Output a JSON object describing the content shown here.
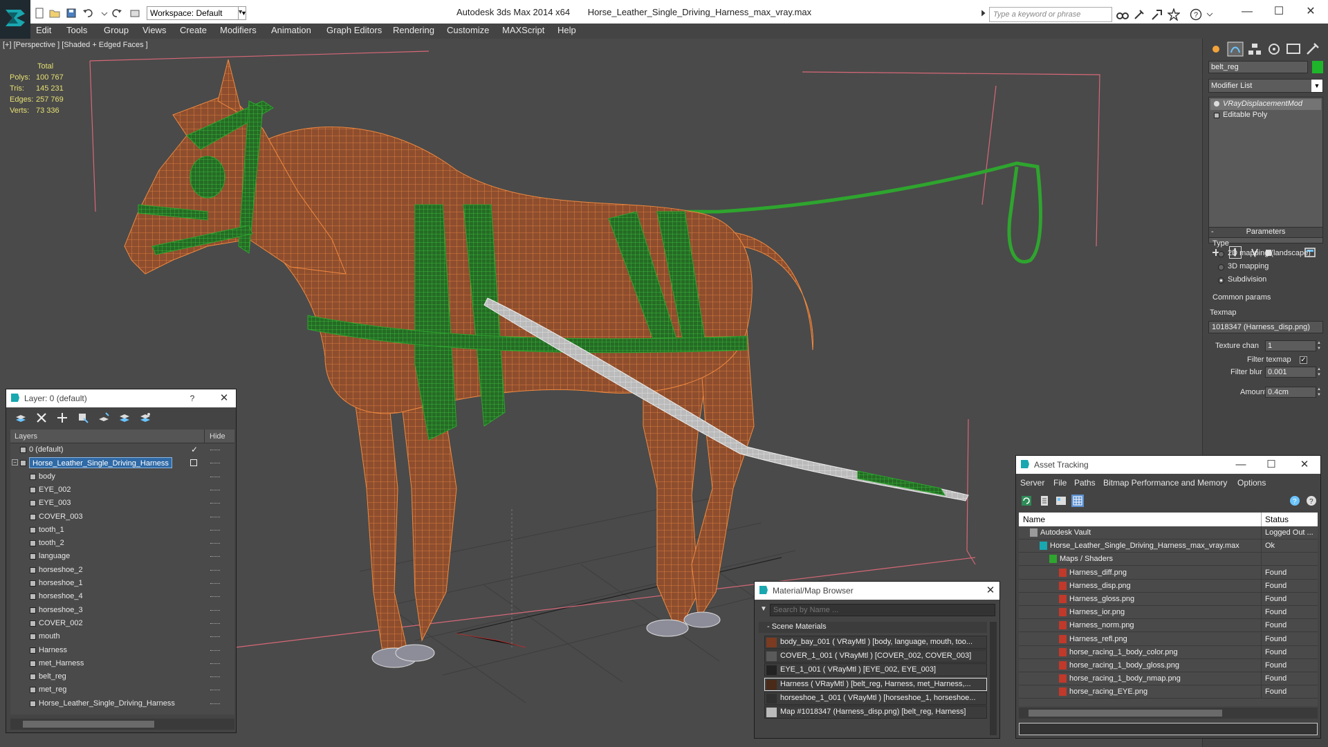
{
  "titlebar": {
    "workspace_label": "Workspace: Default",
    "app_name": "Autodesk 3ds Max  2014 x64",
    "file_name": "Horse_Leather_Single_Driving_Harness_max_vray.max",
    "search_placeholder": "Type a keyword or phrase"
  },
  "menubar": {
    "items": [
      "Edit",
      "Tools",
      "Group",
      "Views",
      "Create",
      "Modifiers",
      "Animation",
      "Graph Editors",
      "Rendering",
      "Customize",
      "MAXScript",
      "Help"
    ]
  },
  "viewport": {
    "label": "[+] [Perspective ] [Shaded + Edged Faces ]",
    "stats": {
      "header": "Total",
      "rows": [
        {
          "label": "Polys:",
          "value": "100 767"
        },
        {
          "label": "Tris:",
          "value": "145 231"
        },
        {
          "label": "Edges:",
          "value": "257 769"
        },
        {
          "label": "Verts:",
          "value": "73 336"
        }
      ]
    },
    "colors": {
      "background": "#4a4a4a",
      "horse": "#8a4a2c",
      "wire": "#f08a40",
      "harness": "#2ea52e"
    }
  },
  "command_panel": {
    "object_name": "belt_reg",
    "object_color": "#1fb52b",
    "modifier_list_label": "Modifier List",
    "stack": [
      "VRayDisplacementMod",
      "Editable Poly"
    ],
    "parameters_title": "Parameters",
    "type_label": "Type",
    "type_options": [
      "2D mapping (landscape)",
      "3D mapping",
      "Subdivision"
    ],
    "type_selected": 2,
    "common_params_label": "Common params",
    "texmap_label": "Texmap",
    "texmap_value": "1018347 (Harness_disp.png)",
    "texture_chan_label": "Texture chan",
    "texture_chan_value": "1",
    "filter_texmap_label": "Filter texmap",
    "filter_blur_label": "Filter blur",
    "filter_blur_value": "0.001",
    "amount_label": "Amount",
    "amount_value": "0.4cm"
  },
  "layer_manager": {
    "title": "Layer: 0 (default)",
    "help": "?",
    "col_layers": "Layers",
    "col_hide": "Hide",
    "rows": [
      {
        "label": "0 (default)",
        "indent": 1,
        "check": "✓"
      },
      {
        "label": "Horse_Leather_Single_Driving_Harness",
        "indent": 1,
        "active": true
      },
      {
        "label": "body",
        "indent": 2
      },
      {
        "label": "EYE_002",
        "indent": 2
      },
      {
        "label": "EYE_003",
        "indent": 2
      },
      {
        "label": "COVER_003",
        "indent": 2
      },
      {
        "label": "tooth_1",
        "indent": 2
      },
      {
        "label": "tooth_2",
        "indent": 2
      },
      {
        "label": "language",
        "indent": 2
      },
      {
        "label": "horseshoe_2",
        "indent": 2
      },
      {
        "label": "horseshoe_1",
        "indent": 2
      },
      {
        "label": "horseshoe_4",
        "indent": 2
      },
      {
        "label": "horseshoe_3",
        "indent": 2
      },
      {
        "label": "COVER_002",
        "indent": 2
      },
      {
        "label": "mouth",
        "indent": 2
      },
      {
        "label": "Harness",
        "indent": 2
      },
      {
        "label": "met_Harness",
        "indent": 2
      },
      {
        "label": "belt_reg",
        "indent": 2
      },
      {
        "label": "met_reg",
        "indent": 2
      },
      {
        "label": "Horse_Leather_Single_Driving_Harness",
        "indent": 2
      }
    ]
  },
  "material_browser": {
    "title": "Material/Map Browser",
    "search_placeholder": "Search by Name ...",
    "section": "- Scene Materials",
    "rows": [
      "body_bay_001  ( VRayMtl ) [body, language, mouth, too...",
      "COVER_1_001  ( VRayMtl ) [COVER_002, COVER_003]",
      "EYE_1_001  ( VRayMtl ) [EYE_002, EYE_003]",
      "Harness  ( VRayMtl ) [belt_reg, Harness, met_Harness,...",
      "horseshoe_1_001  ( VRayMtl ) [horseshoe_1, horseshoe...",
      "Map #1018347 (Harness_disp.png)  [belt_reg, Harness]"
    ],
    "selected": 3
  },
  "asset_tracking": {
    "title": "Asset Tracking",
    "menu": [
      "Server",
      "File",
      "Paths",
      "Bitmap Performance and Memory",
      "Options"
    ],
    "col_name": "Name",
    "col_status": "Status",
    "rows": [
      {
        "name": "Autodesk Vault",
        "status": "Logged Out ...",
        "indent": 1,
        "icon": "vault"
      },
      {
        "name": "Horse_Leather_Single_Driving_Harness_max_vray.max",
        "status": "Ok",
        "indent": 2,
        "icon": "max"
      },
      {
        "name": "Maps / Shaders",
        "status": "",
        "indent": 3,
        "icon": "maps"
      },
      {
        "name": "Harness_diff.png",
        "status": "Found",
        "indent": 4,
        "icon": "png"
      },
      {
        "name": "Harness_disp.png",
        "status": "Found",
        "indent": 4,
        "icon": "png"
      },
      {
        "name": "Harness_gloss.png",
        "status": "Found",
        "indent": 4,
        "icon": "png"
      },
      {
        "name": "Harness_ior.png",
        "status": "Found",
        "indent": 4,
        "icon": "png"
      },
      {
        "name": "Harness_norm.png",
        "status": "Found",
        "indent": 4,
        "icon": "png"
      },
      {
        "name": "Harness_refl.png",
        "status": "Found",
        "indent": 4,
        "icon": "png"
      },
      {
        "name": "horse_racing_1_body_color.png",
        "status": "Found",
        "indent": 4,
        "icon": "png"
      },
      {
        "name": "horse_racing_1_body_gloss.png",
        "status": "Found",
        "indent": 4,
        "icon": "png"
      },
      {
        "name": "horse_racing_1_body_nmap.png",
        "status": "Found",
        "indent": 4,
        "icon": "png"
      },
      {
        "name": "horse_racing_EYE.png",
        "status": "Found",
        "indent": 4,
        "icon": "png"
      }
    ]
  }
}
